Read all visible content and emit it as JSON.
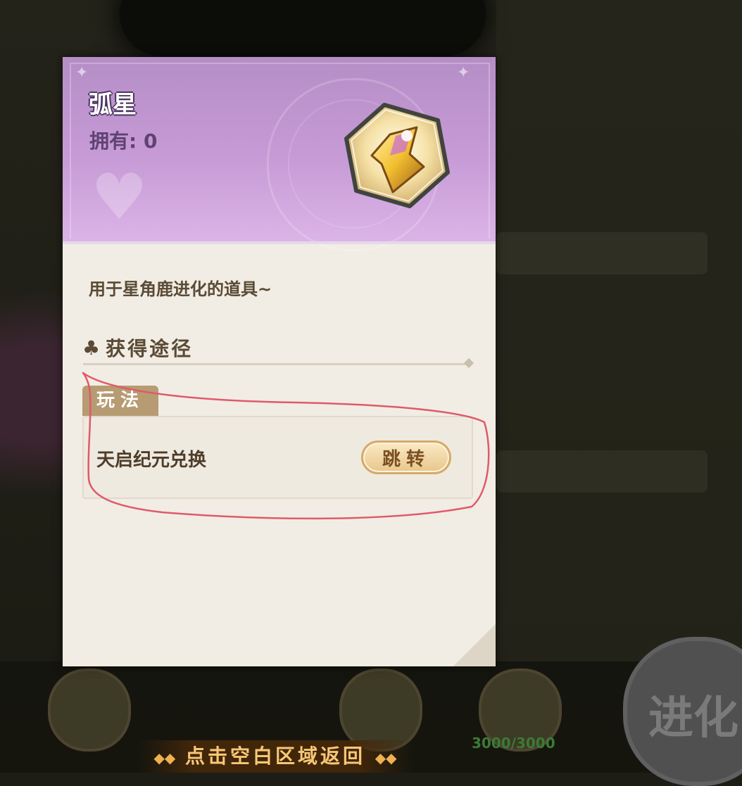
{
  "item": {
    "name": "弧星",
    "owned_label": "拥有: 0",
    "description": "用于星角鹿进化的道具~"
  },
  "section": {
    "title": "获得途径"
  },
  "route": {
    "tag": "玩法",
    "name": "天启纪元兑换",
    "button": "跳转"
  },
  "hint": {
    "text": "点击空白区域返回"
  },
  "background": {
    "evolve_label": "进化",
    "counter": "3000/3000"
  },
  "colors": {
    "header_purple": "#c79bd6",
    "body_paper": "#f1ede4",
    "annotation_red": "#e05a6a"
  }
}
